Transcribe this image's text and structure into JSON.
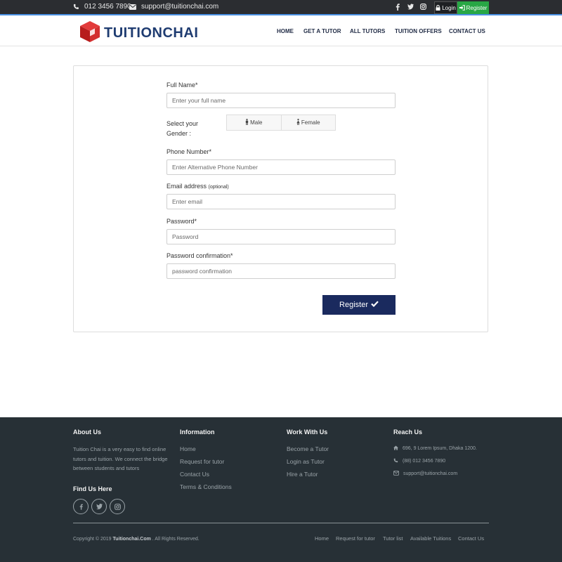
{
  "topbar": {
    "phone": "012 3456 7890",
    "email": "support@tuitionchai.com",
    "social": [
      "facebook-icon",
      "twitter-icon",
      "instagram-icon"
    ],
    "login_label": "Login",
    "register_label": "Register"
  },
  "header": {
    "brand": "TUITIONCHAI",
    "nav": [
      "HOME",
      "GET A TUTOR",
      "ALL TUTORS",
      "TUITION OFFERS",
      "CONTACT US"
    ]
  },
  "form": {
    "full_name": {
      "label": "Full Name*",
      "placeholder": "Enter your full name"
    },
    "gender": {
      "label": "Select your Gender :",
      "options": [
        "Male",
        "Female"
      ]
    },
    "phone": {
      "label": "Phone Number*",
      "placeholder": "Enter Alternative Phone Number"
    },
    "email": {
      "label": "Email address",
      "hint": "(optional)",
      "placeholder": "Enter email"
    },
    "password": {
      "label": "Password*",
      "placeholder": "Password"
    },
    "password_confirm": {
      "label": "Password confirmation*",
      "placeholder": "password confirmation"
    },
    "submit_label": "Register"
  },
  "footer": {
    "about": {
      "title": "About Us",
      "text": "Tuition Chai is a very easy to find online tutors and tuition. We connect the bridge between students and tutors"
    },
    "find_us": {
      "title": "Find Us Here"
    },
    "information": {
      "title": "Information",
      "links": [
        "Home",
        "Request for tutor",
        "Contact Us",
        "Terms & Conditions"
      ]
    },
    "work": {
      "title": "Work With Us",
      "links": [
        "Become a Tutor",
        "Login as Tutor",
        "Hire a Tutor"
      ]
    },
    "reach": {
      "title": "Reach Us",
      "address": "696, 9 Lorem Ipsum, Dhaka 1200.",
      "phone": "(88) 012 3456 7890",
      "email": "support@tuitionchai.com"
    },
    "copyright_prefix": "Copyright © 2019",
    "copyright_brand": "Tuitionchai.Com",
    "copyright_suffix": ". All Rights Reserved.",
    "bottom_links": [
      "Home",
      "Request for tutor",
      "Tutor list",
      "Available Tuitions",
      "Contact Us"
    ]
  },
  "colors": {
    "topbar_bg": "#2b2d31",
    "brand_navy": "#1f3c71",
    "logo_red": "#c62828",
    "register_green": "#28a745",
    "submit_navy": "#1a2a5e",
    "footer_bg": "#273036"
  }
}
